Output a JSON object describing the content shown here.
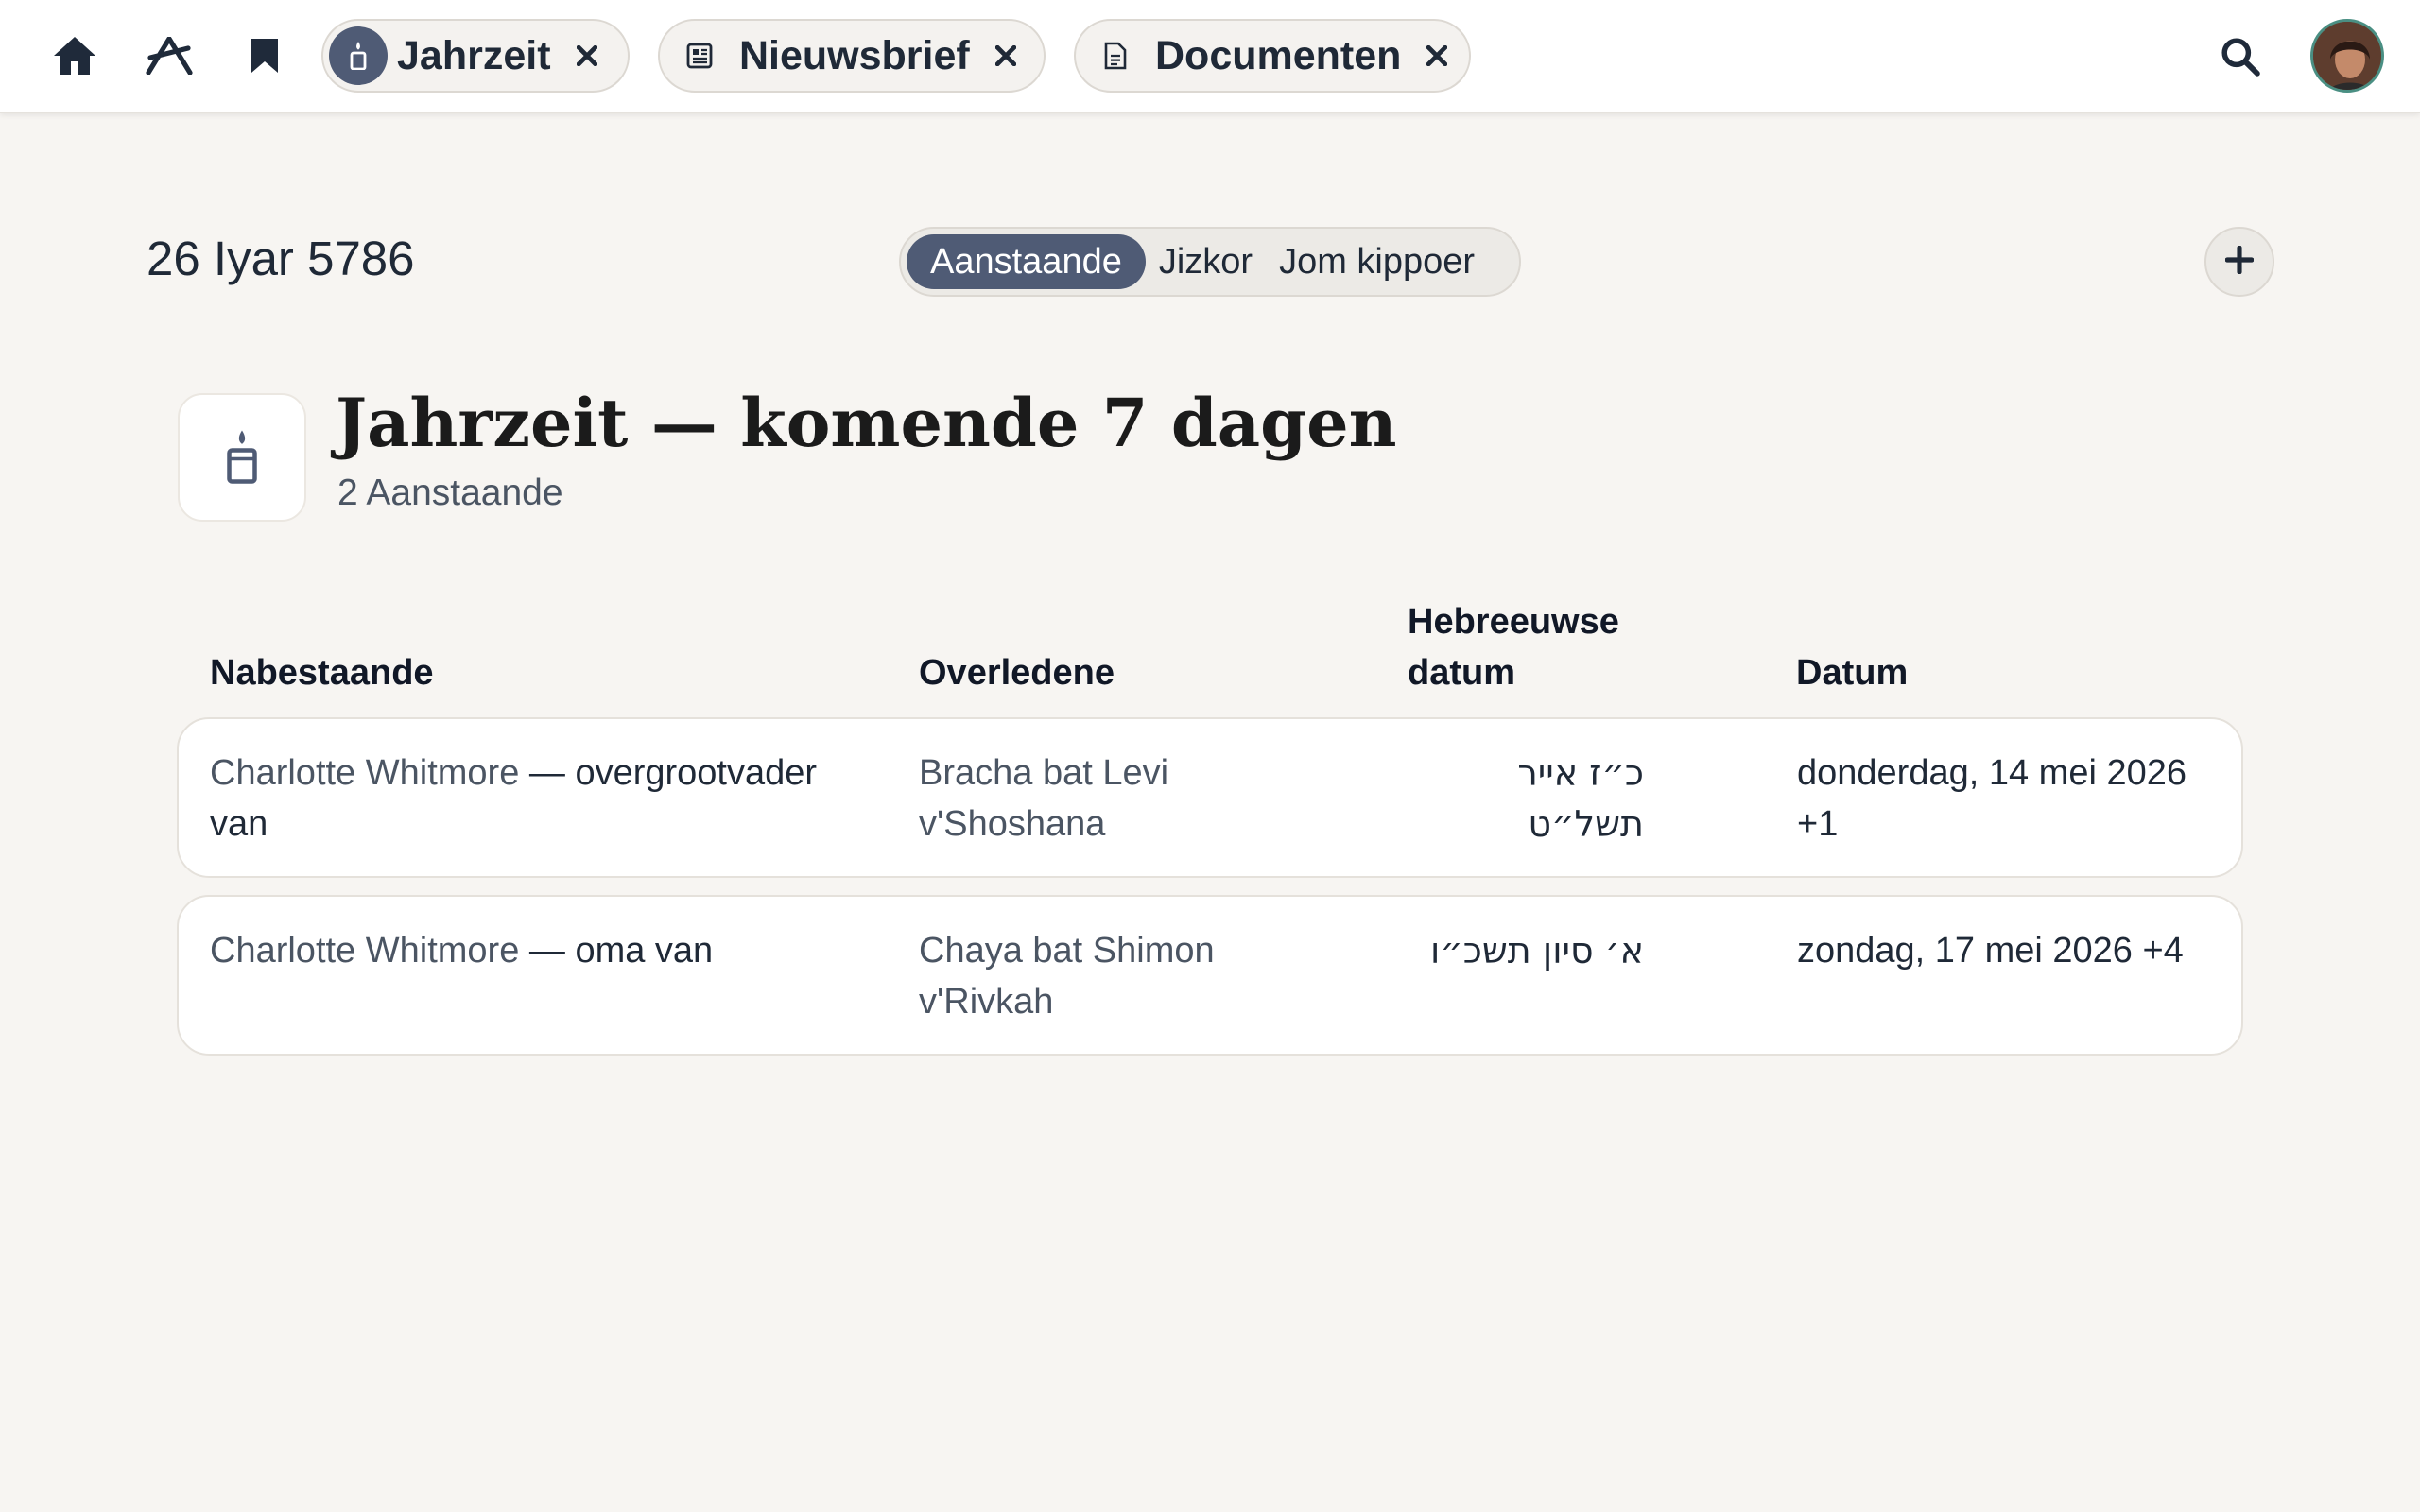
{
  "nav": {
    "home_icon": "home-icon",
    "tools_icon": "compass-icon",
    "bookmark_icon": "bookmark-icon",
    "search_icon": "search-icon",
    "avatar_icon": "user-avatar"
  },
  "tabs": [
    {
      "label": "Jahrzeit",
      "icon": "candle-icon",
      "close_icon": "close-icon"
    },
    {
      "label": "Nieuwsbrief",
      "icon": "newspaper-icon",
      "close_icon": "close-icon"
    },
    {
      "label": "Documenten",
      "icon": "document-icon",
      "close_icon": "close-icon"
    }
  ],
  "subheader": {
    "hebrew_date": "26 Iyar 5786",
    "segments": [
      "Aanstaande",
      "Jizkor",
      "Jom kippoer"
    ],
    "active_segment": "Aanstaande",
    "add_icon": "plus-icon"
  },
  "page": {
    "title": "Jahrzeit — komende 7 dagen",
    "subtitle": "2 Aanstaande",
    "icon": "candle-icon"
  },
  "table": {
    "headers": {
      "mourner": "Nabestaande",
      "deceased": "Overledene",
      "hebrew_date_line1": "Hebreeuwse",
      "hebrew_date_line2": "datum",
      "date": "Datum"
    },
    "rows": [
      {
        "mourner_name": "Charlotte Whitmore",
        "relation_line1": " — overgrootvader",
        "relation_line2": "van",
        "deceased_line1": "Bracha bat Levi",
        "deceased_line2": "v'Shoshana",
        "hebrew_date": "כ״ז אייר תשל״ט",
        "date_line1": "donderdag, 14 mei 2026",
        "date_line2": "+1"
      },
      {
        "mourner_name": "Charlotte Whitmore",
        "relation_line1": " — oma van",
        "relation_line2": "",
        "deceased_line1": "Chaya bat Shimon",
        "deceased_line2": "v'Rivkah",
        "hebrew_date": "א׳ סיון תשכ״ו",
        "date_line1": "zondag, 17 mei 2026 +4",
        "date_line2": ""
      }
    ]
  },
  "colors": {
    "background": "#f7f5f2",
    "accent": "#4f5b75",
    "topbar": "#ffffff"
  }
}
